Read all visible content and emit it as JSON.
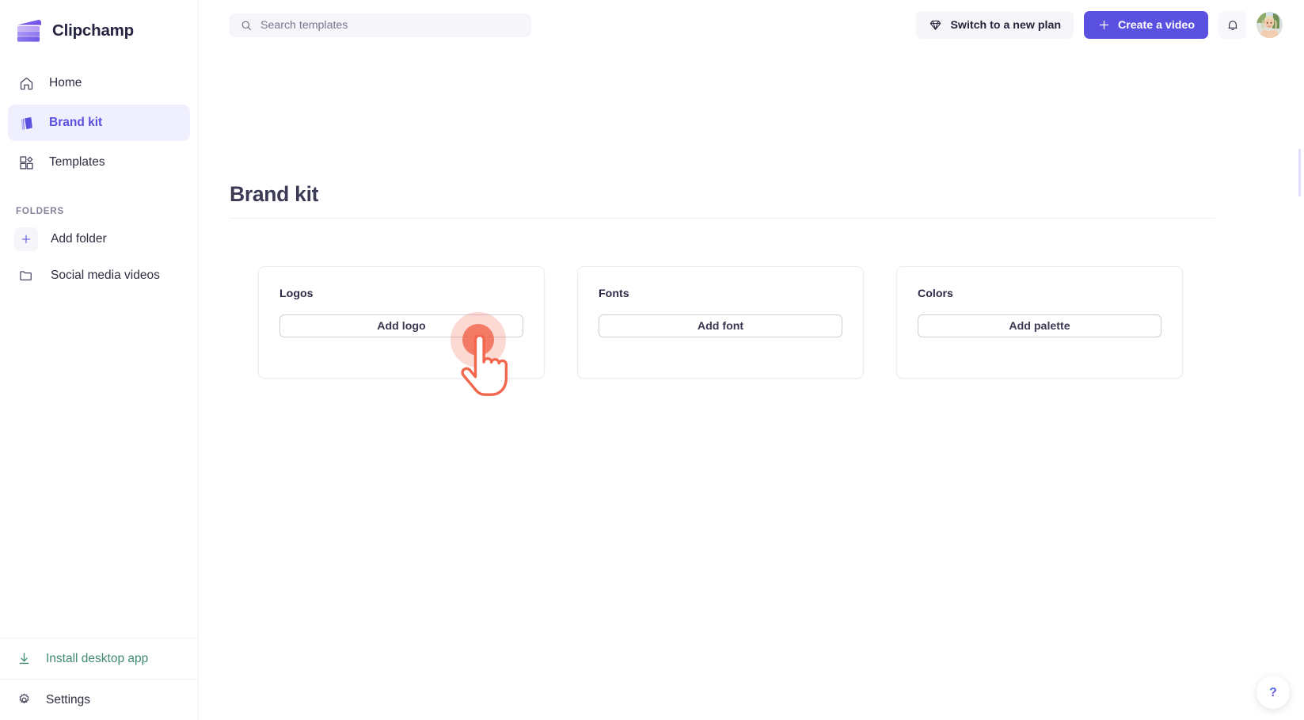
{
  "brand": {
    "name": "Clipchamp",
    "logo_icon": "clipchamp-clapperboard-logo"
  },
  "sidebar": {
    "nav_items": [
      {
        "label": "Home",
        "icon": "home-icon",
        "active": false
      },
      {
        "label": "Brand kit",
        "icon": "brand-kit-icon",
        "active": true
      },
      {
        "label": "Templates",
        "icon": "templates-grid-icon",
        "active": false
      }
    ],
    "folders_heading": "FOLDERS",
    "folder_items": [
      {
        "label": "Add folder",
        "icon": "plus-icon"
      },
      {
        "label": "Social media videos",
        "icon": "folder-icon"
      }
    ],
    "bottom_items": [
      {
        "label": "Install desktop app",
        "icon": "download-icon",
        "color": "#3f8a6e"
      },
      {
        "label": "Settings",
        "icon": "gear-icon",
        "color": "#2f2e41"
      }
    ]
  },
  "topbar": {
    "search_placeholder": "Search templates",
    "search_value": "",
    "search_icon": "search-icon",
    "plan_button": {
      "label": "Switch to a new plan",
      "icon": "diamond-icon"
    },
    "create_button": {
      "label": "Create a video",
      "icon": "plus-icon"
    },
    "notifications_icon": "bell-icon",
    "avatar_icon": "user-avatar"
  },
  "main": {
    "page_title": "Brand kit",
    "cards": [
      {
        "title": "Logos",
        "button_label": "Add logo"
      },
      {
        "title": "Fonts",
        "button_label": "Add font"
      },
      {
        "title": "Colors",
        "button_label": "Add palette"
      }
    ]
  },
  "help": {
    "icon": "question-mark-icon"
  },
  "colors": {
    "accent_purple": "#5b51e0",
    "active_nav_bg": "#f0effe",
    "active_nav_text": "#5b4fe0",
    "install_green": "#3f8a6e",
    "cursor_orange": "#f05f46",
    "card_border": "#ececf2",
    "search_bg": "#f5f5fa",
    "title_text": "#3c3b55"
  }
}
